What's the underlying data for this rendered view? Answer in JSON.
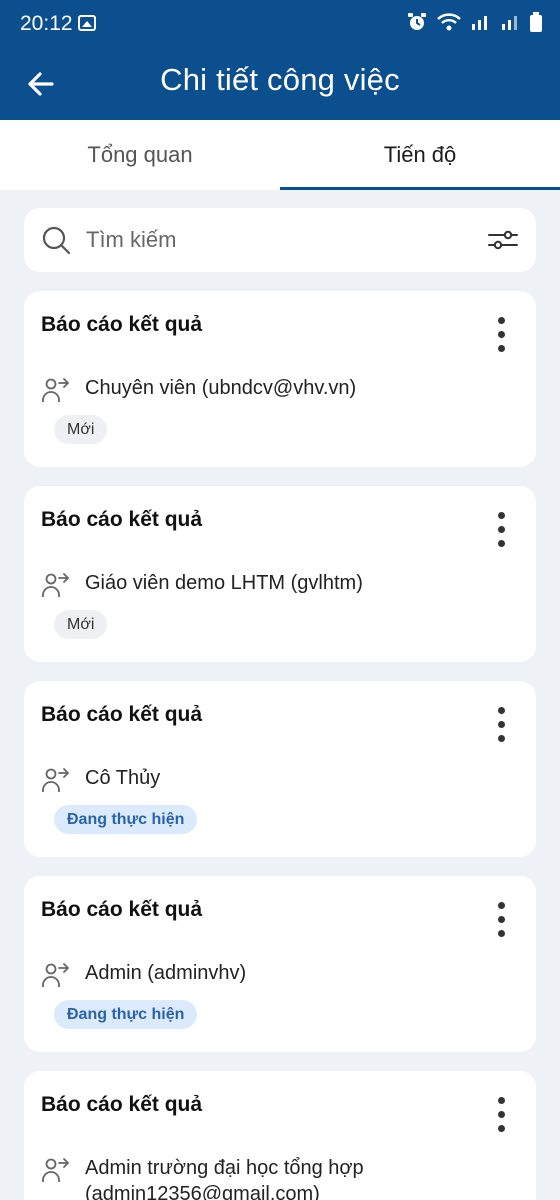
{
  "status_bar": {
    "time": "20:12"
  },
  "appbar": {
    "title": "Chi tiết công việc"
  },
  "tabs": [
    {
      "label": "Tổng quan",
      "active": false
    },
    {
      "label": "Tiến độ",
      "active": true
    }
  ],
  "search": {
    "placeholder": "Tìm kiếm"
  },
  "cards": [
    {
      "title": "Báo cáo kết quả",
      "assignee": "Chuyên viên (ubndcv@vhv.vn)",
      "status": "Mới"
    },
    {
      "title": "Báo cáo kết quả",
      "assignee": "Giáo viên demo LHTM (gvlhtm)",
      "status": "Mới"
    },
    {
      "title": "Báo cáo kết quả",
      "assignee": "Cô Thủy",
      "status": "Đang thực hiện"
    },
    {
      "title": "Báo cáo kết quả",
      "assignee": "Admin (adminvhv)",
      "status": "Đang thực hiện"
    },
    {
      "title": "Báo cáo kết quả",
      "assignee": "Admin trường đại học tổng hợp (admin12356@gmail.com)",
      "status": ""
    }
  ],
  "colors": {
    "primary": "#0b4f8e",
    "background": "#eef1f5",
    "badge_new": "#eef0f3",
    "badge_doing": "#dbeafc",
    "badge_doing_text": "#2b63a9"
  }
}
